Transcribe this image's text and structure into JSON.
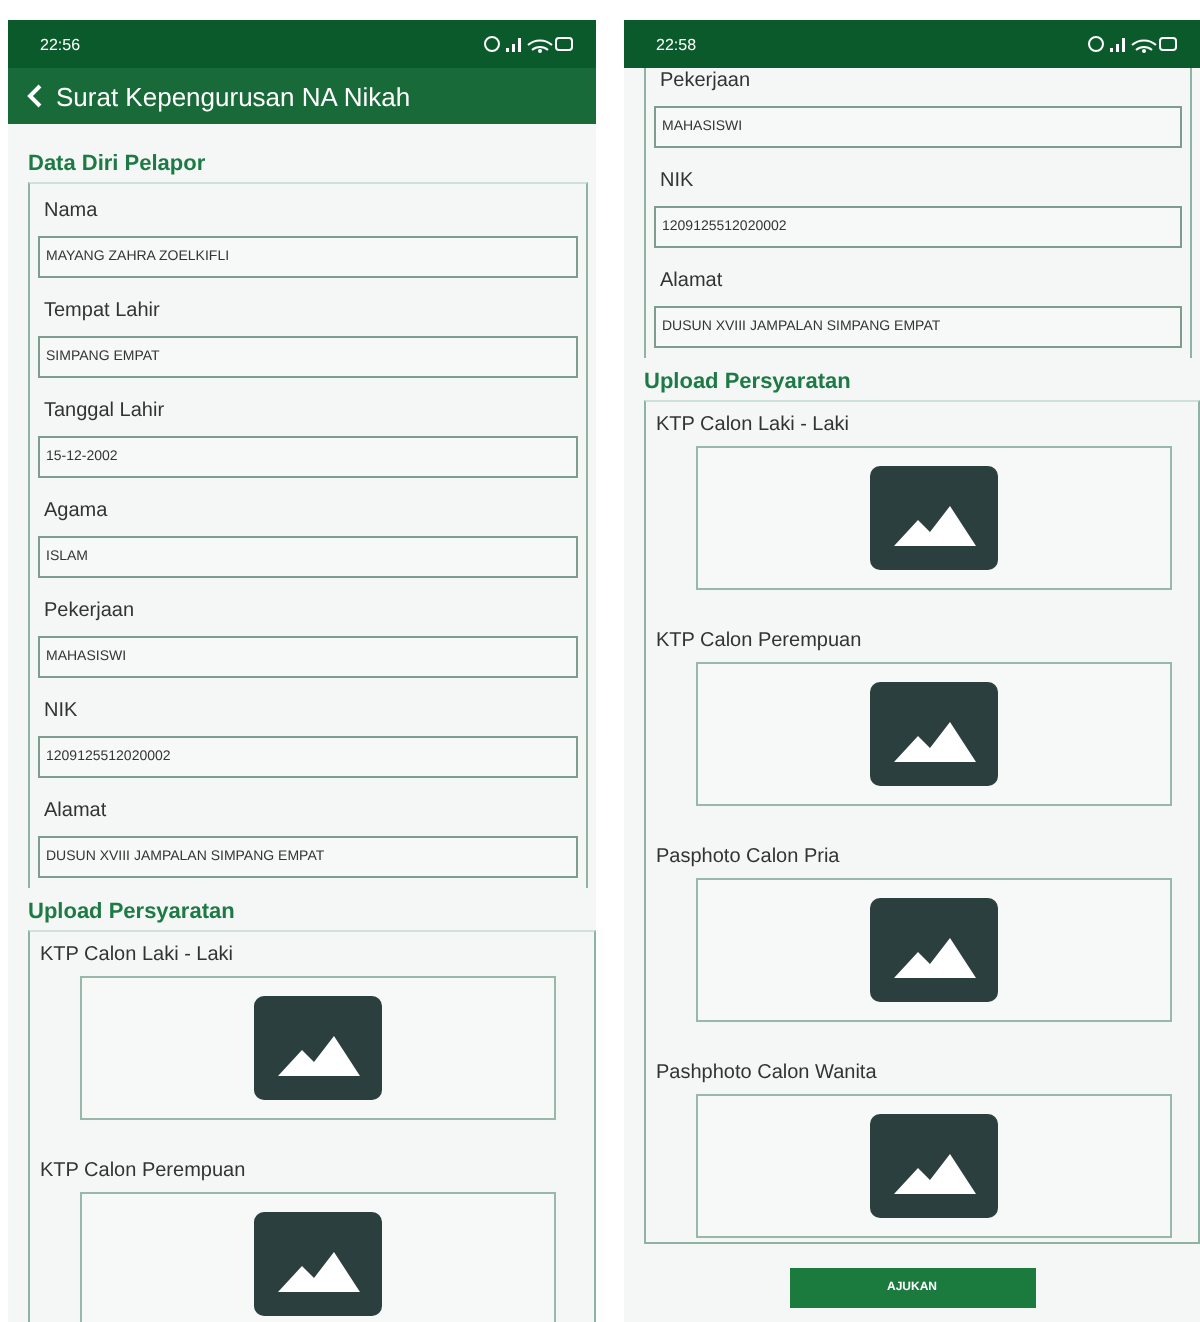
{
  "screens": [
    {
      "status_time": "22:56",
      "app_bar": {
        "title": "Surat Kepengurusan NA Nikah"
      },
      "sections": [
        {
          "kind": "fields",
          "title": "Data Diri Pelapor",
          "fields": [
            {
              "label": "Nama",
              "value": "MAYANG ZAHRA ZOELKIFLI"
            },
            {
              "label": "Tempat Lahir",
              "value": "SIMPANG EMPAT"
            },
            {
              "label": "Tanggal Lahir",
              "value": "15-12-2002"
            },
            {
              "label": "Agama",
              "value": "ISLAM"
            },
            {
              "label": "Pekerjaan",
              "value": "MAHASISWI"
            },
            {
              "label": "NIK",
              "value": "1209125512020002"
            },
            {
              "label": "Alamat",
              "value": "DUSUN XVIII JAMPALAN SIMPANG EMPAT"
            }
          ]
        },
        {
          "kind": "uploads",
          "title": "Upload Persyaratan",
          "uploads": [
            {
              "label": "KTP Calon Laki - Laki"
            },
            {
              "label": "KTP Calon Perempuan"
            }
          ]
        }
      ]
    },
    {
      "status_time": "22:58",
      "sections": [
        {
          "kind": "fields",
          "fields": [
            {
              "label": "Pekerjaan",
              "value": "MAHASISWI"
            },
            {
              "label": "NIK",
              "value": "1209125512020002"
            },
            {
              "label": "Alamat",
              "value": "DUSUN XVIII JAMPALAN SIMPANG EMPAT"
            }
          ]
        },
        {
          "kind": "uploads",
          "title": "Upload Persyaratan",
          "uploads": [
            {
              "label": "KTP Calon Laki - Laki"
            },
            {
              "label": "KTP Calon Perempuan"
            },
            {
              "label": "Pasphoto Calon Pria"
            },
            {
              "label": "Pashphoto Calon Wanita"
            }
          ]
        }
      ],
      "submit_button": "AJUKAN"
    }
  ]
}
